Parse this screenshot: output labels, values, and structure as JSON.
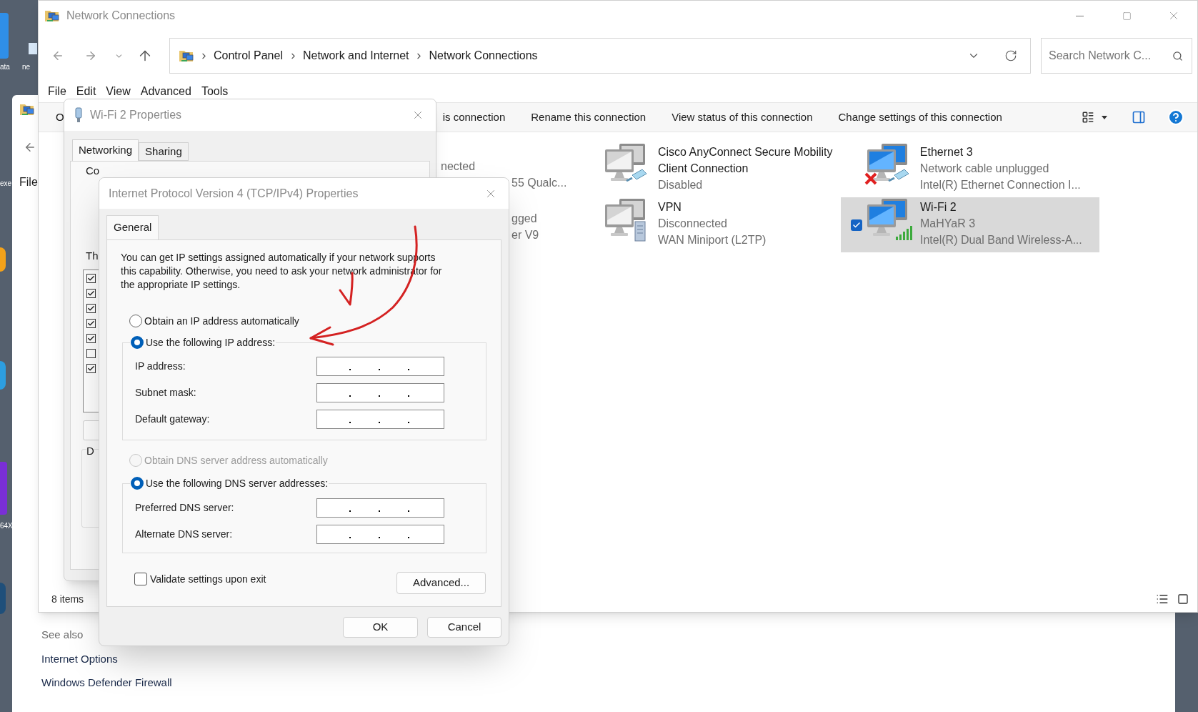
{
  "desktop": {
    "labels": [
      "ata",
      "ne",
      "exe",
      "64X"
    ]
  },
  "back_window": {
    "menu_item": "File",
    "see_also": {
      "heading": "See also",
      "links": [
        "Internet Options",
        "Windows Defender Firewall"
      ]
    }
  },
  "window": {
    "title": "Network Connections",
    "breadcrumb": [
      "Control Panel",
      "Network and Internet",
      "Network Connections"
    ],
    "search": {
      "placeholder": "Search Network C..."
    },
    "menu": [
      "File",
      "Edit",
      "View",
      "Advanced",
      "Tools"
    ],
    "command_fragments": {
      "left": "O",
      "right": "is connection"
    },
    "commands": [
      "Rename this connection",
      "View status of this connection",
      "Change settings of this connection"
    ],
    "partial_items": [
      {
        "lines": [
          "nected",
          "55 Qualc..."
        ]
      },
      {
        "lines": [
          "gged",
          "er V9"
        ]
      }
    ],
    "connections": [
      {
        "kind": "cable",
        "active": false,
        "error": false,
        "selected": false,
        "lines": [
          "Cisco AnyConnect Secure Mobility Client Connection",
          "Disabled"
        ]
      },
      {
        "kind": "cable",
        "active": true,
        "error": true,
        "selected": false,
        "lines": [
          "Ethernet 3",
          "Network cable unplugged",
          "Intel(R) Ethernet Connection I..."
        ]
      },
      {
        "kind": "server",
        "active": false,
        "error": false,
        "selected": false,
        "lines": [
          "VPN",
          "Disconnected",
          "WAN Miniport (L2TP)"
        ]
      },
      {
        "kind": "wireless",
        "active": true,
        "error": false,
        "selected": true,
        "lines": [
          "Wi-Fi 2",
          "MaHYaR 3",
          "Intel(R) Dual Band Wireless-A..."
        ]
      }
    ],
    "status_bar": "8 items"
  },
  "wifi_dialog": {
    "title": "Wi-Fi 2 Properties",
    "tabs": [
      {
        "label": "Networking",
        "selected": true
      },
      {
        "label": "Sharing",
        "selected": false
      }
    ],
    "fragments": [
      "Co",
      "Th",
      "D"
    ],
    "components": [
      {
        "checked": true
      },
      {
        "checked": true
      },
      {
        "checked": true
      },
      {
        "checked": true
      },
      {
        "checked": true
      },
      {
        "checked": false
      },
      {
        "checked": true
      }
    ]
  },
  "ipv4_dialog": {
    "title": "Internet Protocol Version 4 (TCP/IPv4) Properties",
    "tabs": [
      {
        "label": "General",
        "selected": true
      }
    ],
    "description": "You can get IP settings assigned automatically if your network supports this capability. Otherwise, you need to ask your network administrator for the appropriate IP settings.",
    "ip_mode": [
      {
        "label": "Obtain an IP address automatically",
        "selected": false,
        "disabled": false
      },
      {
        "label": "Use the following IP address:",
        "selected": true,
        "disabled": false
      }
    ],
    "ip_fields": [
      {
        "label": "IP address:"
      },
      {
        "label": "Subnet mask:"
      },
      {
        "label": "Default gateway:"
      }
    ],
    "dns_mode": [
      {
        "label": "Obtain DNS server address automatically",
        "selected": false,
        "disabled": true
      },
      {
        "label": "Use the following DNS server addresses:",
        "selected": true,
        "disabled": false
      }
    ],
    "dns_fields": [
      {
        "label": "Preferred DNS server:"
      },
      {
        "label": "Alternate DNS server:"
      }
    ],
    "validate": {
      "label": "Validate settings upon exit",
      "checked": false
    },
    "buttons": {
      "advanced": "Advanced...",
      "ok": "OK",
      "cancel": "Cancel"
    }
  }
}
